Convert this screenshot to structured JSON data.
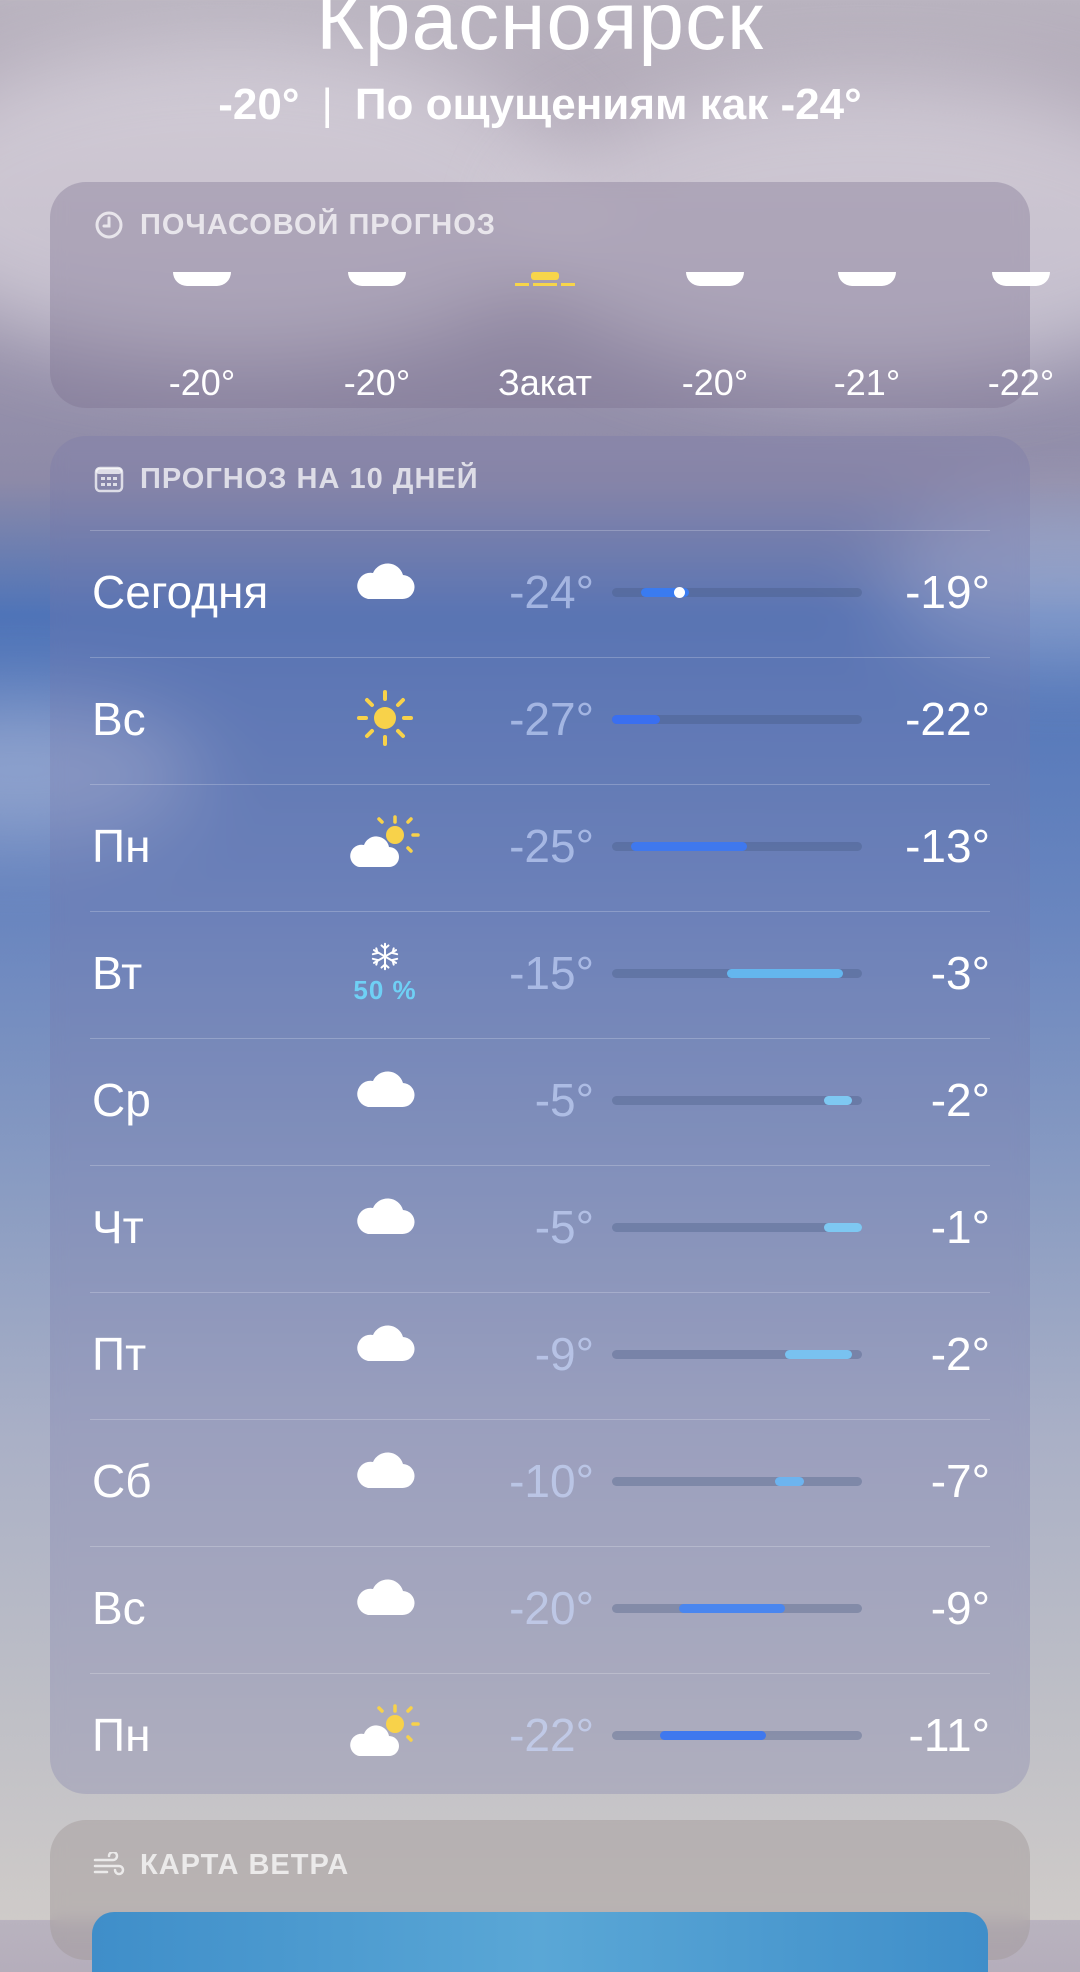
{
  "header": {
    "city": "Красноярск",
    "temp": "-20°",
    "feels": "По ощущениям как -24°"
  },
  "hourly": {
    "title": "ПОЧАСОВОЙ ПРОГНОЗ",
    "icon": "clock-icon",
    "items": [
      {
        "icon": "cloud-icon",
        "label": "-20°"
      },
      {
        "icon": "cloud-icon",
        "label": "-20°"
      },
      {
        "icon": "sunset-icon",
        "label": "Закат"
      },
      {
        "icon": "cloud-icon",
        "label": "-20°"
      },
      {
        "icon": "cloud-icon",
        "label": "-21°"
      },
      {
        "icon": "cloud-icon",
        "label": "-22°"
      }
    ]
  },
  "daily": {
    "title": "ПРОГНОЗ НА 10 ДНЕЙ",
    "icon": "calendar-icon",
    "range": [
      -27,
      -1
    ],
    "days": [
      {
        "name": "Сегодня",
        "icon": "cloud-icon",
        "low": "-24°",
        "high": "-19°",
        "low_val": -24,
        "high_val": -19,
        "current_val": -20,
        "color": "#3a7bf0"
      },
      {
        "name": "Вс",
        "icon": "sun-icon",
        "low": "-27°",
        "high": "-22°",
        "low_val": -27,
        "high_val": -22,
        "color": "#3a6ff0"
      },
      {
        "name": "Пн",
        "icon": "partly-sunny-icon",
        "low": "-25°",
        "high": "-13°",
        "low_val": -25,
        "high_val": -13,
        "color": "#3f78ee"
      },
      {
        "name": "Вт",
        "icon": "snowflake-icon",
        "precip": "50 %",
        "low": "-15°",
        "high": "-3°",
        "low_val": -15,
        "high_val": -3,
        "color": "#64b6ee"
      },
      {
        "name": "Ср",
        "icon": "cloud-icon",
        "low": "-5°",
        "high": "-2°",
        "low_val": -5,
        "high_val": -2,
        "color": "#7ec8f2"
      },
      {
        "name": "Чт",
        "icon": "cloud-icon",
        "low": "-5°",
        "high": "-1°",
        "low_val": -5,
        "high_val": -1,
        "color": "#7ec8f2"
      },
      {
        "name": "Пт",
        "icon": "cloud-icon",
        "low": "-9°",
        "high": "-2°",
        "low_val": -9,
        "high_val": -2,
        "color": "#79c2f0"
      },
      {
        "name": "Сб",
        "icon": "cloud-icon",
        "low": "-10°",
        "high": "-7°",
        "low_val": -10,
        "high_val": -7,
        "color": "#6db4ef"
      },
      {
        "name": "Вс",
        "icon": "cloud-icon",
        "low": "-20°",
        "high": "-9°",
        "low_val": -20,
        "high_val": -9,
        "color": "#4a86ef"
      },
      {
        "name": "Пн",
        "icon": "partly-sunny-icon",
        "low": "-22°",
        "high": "-11°",
        "low_val": -22,
        "high_val": -11,
        "color": "#3f78ee"
      }
    ]
  },
  "wind": {
    "title": "КАРТА ВЕТРА",
    "icon": "wind-icon"
  }
}
